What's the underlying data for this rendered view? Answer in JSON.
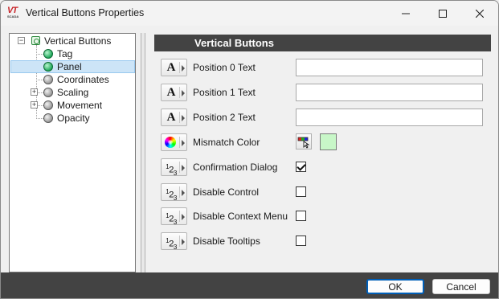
{
  "window": {
    "title": "Vertical Buttons Properties",
    "logo_text": "VT",
    "logo_subtext": "SCADA"
  },
  "tree": {
    "root": {
      "label": "Vertical Buttons",
      "expanded": true
    },
    "items": [
      {
        "label": "Tag",
        "icon": "green-ball-icon",
        "selected": false,
        "expandable": false
      },
      {
        "label": "Panel",
        "icon": "green-ball-icon",
        "selected": true,
        "expandable": false
      },
      {
        "label": "Coordinates",
        "icon": "gray-ball-icon",
        "selected": false,
        "expandable": false
      },
      {
        "label": "Scaling",
        "icon": "gray-ball-icon",
        "selected": false,
        "expandable": true
      },
      {
        "label": "Movement",
        "icon": "gray-ball-icon",
        "selected": false,
        "expandable": true
      },
      {
        "label": "Opacity",
        "icon": "gray-ball-icon",
        "selected": false,
        "expandable": false
      }
    ]
  },
  "panel": {
    "header": "Vertical Buttons",
    "properties": [
      {
        "label": "Position 0 Text",
        "type": "text",
        "value": ""
      },
      {
        "label": "Position 1 Text",
        "type": "text",
        "value": ""
      },
      {
        "label": "Position 2 Text",
        "type": "text",
        "value": ""
      },
      {
        "label": "Mismatch Color",
        "type": "color",
        "value": "#c8f7c8"
      },
      {
        "label": "Confirmation Dialog",
        "type": "bool",
        "checked": true
      },
      {
        "label": "Disable Control",
        "type": "bool",
        "checked": false
      },
      {
        "label": "Disable Context Menu",
        "type": "bool",
        "checked": false
      },
      {
        "label": "Disable Tooltips",
        "type": "bool",
        "checked": false
      }
    ]
  },
  "buttons": {
    "ok": "OK",
    "cancel": "Cancel"
  },
  "colors": {
    "header_bg": "#434343",
    "footer_bg": "#434343",
    "selection_bg": "#cce4f7",
    "ok_border": "#005fb8",
    "swatch": "#c8f7c8"
  }
}
